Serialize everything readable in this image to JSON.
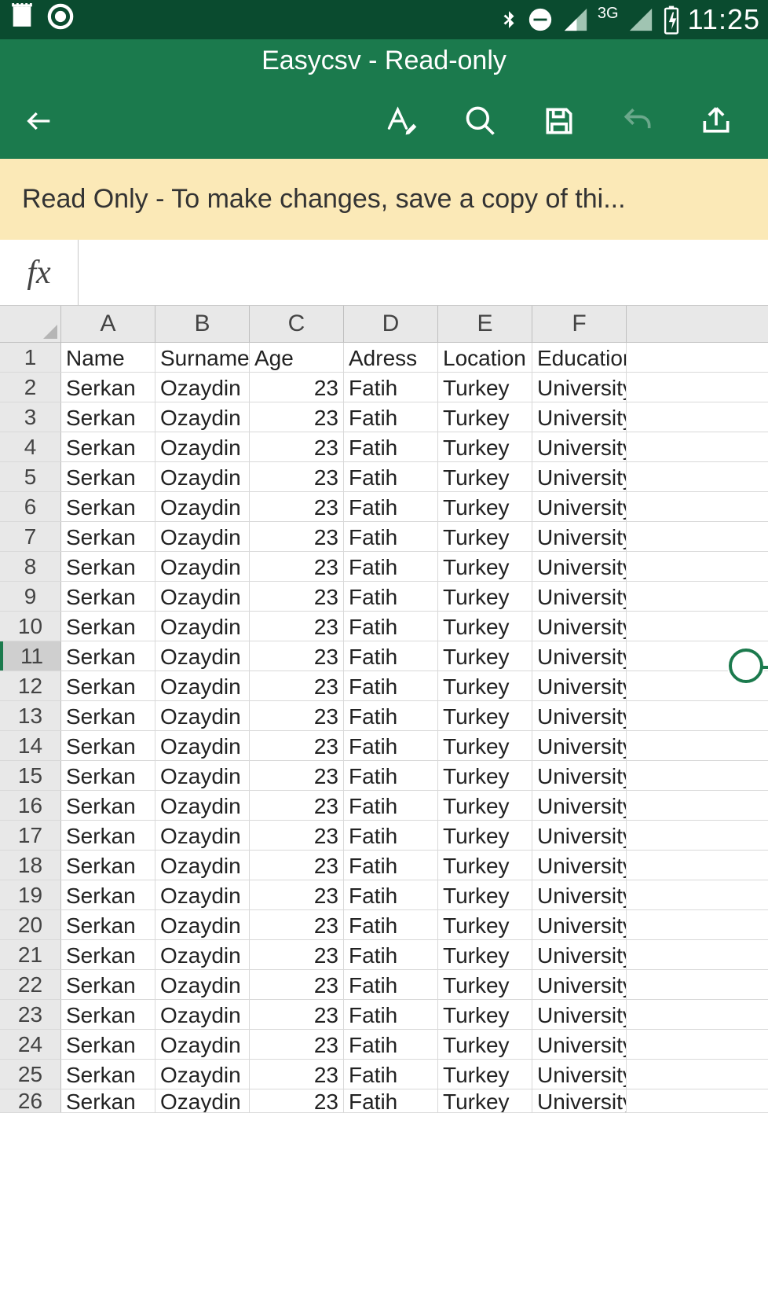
{
  "status_bar": {
    "network_label": "3G",
    "clock": "11:25"
  },
  "header": {
    "title": "Easycsv - Read-only"
  },
  "banner": {
    "text": "Read Only - To make changes, save a copy of thi..."
  },
  "formula_bar": {
    "fx_label": "fx",
    "value": ""
  },
  "chart_data": {
    "type": "table",
    "columns": [
      "A",
      "B",
      "C",
      "D",
      "E",
      "F"
    ],
    "headers": [
      "Name",
      "Surname",
      "Age",
      "Adress",
      "Location",
      "Education"
    ],
    "row_count": 26,
    "selected_row": 11,
    "data_rows": [
      [
        "Serkan",
        "Ozaydin",
        "23",
        "Fatih",
        "Turkey",
        "University"
      ],
      [
        "Serkan",
        "Ozaydin",
        "23",
        "Fatih",
        "Turkey",
        "University"
      ],
      [
        "Serkan",
        "Ozaydin",
        "23",
        "Fatih",
        "Turkey",
        "University"
      ],
      [
        "Serkan",
        "Ozaydin",
        "23",
        "Fatih",
        "Turkey",
        "University"
      ],
      [
        "Serkan",
        "Ozaydin",
        "23",
        "Fatih",
        "Turkey",
        "University"
      ],
      [
        "Serkan",
        "Ozaydin",
        "23",
        "Fatih",
        "Turkey",
        "University"
      ],
      [
        "Serkan",
        "Ozaydin",
        "23",
        "Fatih",
        "Turkey",
        "University"
      ],
      [
        "Serkan",
        "Ozaydin",
        "23",
        "Fatih",
        "Turkey",
        "University"
      ],
      [
        "Serkan",
        "Ozaydin",
        "23",
        "Fatih",
        "Turkey",
        "University"
      ],
      [
        "Serkan",
        "Ozaydin",
        "23",
        "Fatih",
        "Turkey",
        "University"
      ],
      [
        "Serkan",
        "Ozaydin",
        "23",
        "Fatih",
        "Turkey",
        "University"
      ],
      [
        "Serkan",
        "Ozaydin",
        "23",
        "Fatih",
        "Turkey",
        "University"
      ],
      [
        "Serkan",
        "Ozaydin",
        "23",
        "Fatih",
        "Turkey",
        "University"
      ],
      [
        "Serkan",
        "Ozaydin",
        "23",
        "Fatih",
        "Turkey",
        "University"
      ],
      [
        "Serkan",
        "Ozaydin",
        "23",
        "Fatih",
        "Turkey",
        "University"
      ],
      [
        "Serkan",
        "Ozaydin",
        "23",
        "Fatih",
        "Turkey",
        "University"
      ],
      [
        "Serkan",
        "Ozaydin",
        "23",
        "Fatih",
        "Turkey",
        "University"
      ],
      [
        "Serkan",
        "Ozaydin",
        "23",
        "Fatih",
        "Turkey",
        "University"
      ],
      [
        "Serkan",
        "Ozaydin",
        "23",
        "Fatih",
        "Turkey",
        "University"
      ],
      [
        "Serkan",
        "Ozaydin",
        "23",
        "Fatih",
        "Turkey",
        "University"
      ],
      [
        "Serkan",
        "Ozaydin",
        "23",
        "Fatih",
        "Turkey",
        "University"
      ],
      [
        "Serkan",
        "Ozaydin",
        "23",
        "Fatih",
        "Turkey",
        "University"
      ],
      [
        "Serkan",
        "Ozaydin",
        "23",
        "Fatih",
        "Turkey",
        "University"
      ],
      [
        "Serkan",
        "Ozaydin",
        "23",
        "Fatih",
        "Turkey",
        "University"
      ],
      [
        "Serkan",
        "Ozaydin",
        "23",
        "Fatih",
        "Turkey",
        "University"
      ]
    ]
  }
}
